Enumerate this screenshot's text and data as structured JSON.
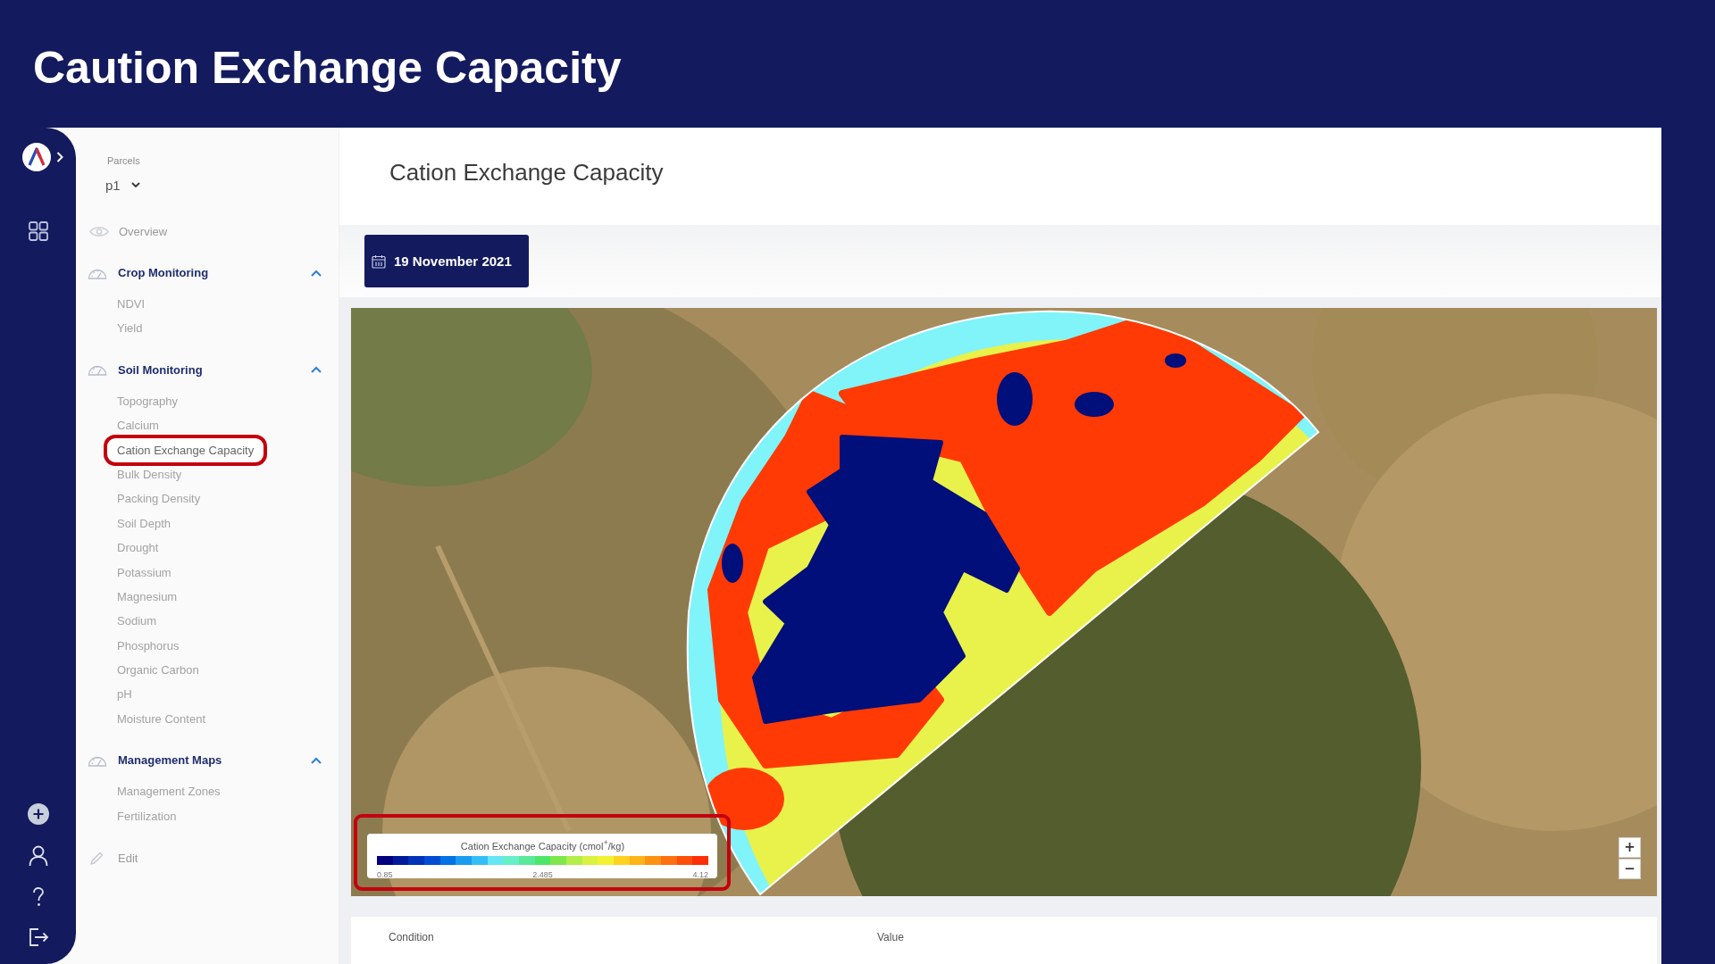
{
  "banner": {
    "title": "Caution Exchange Capacity"
  },
  "sidebar": {
    "parcels": {
      "label": "Parcels",
      "value": "p1"
    },
    "overview": {
      "label": "Overview"
    },
    "sections": [
      {
        "label": "Crop Monitoring",
        "expanded": true,
        "children": [
          {
            "label": "NDVI",
            "selected": false
          },
          {
            "label": "Yield",
            "selected": false
          }
        ]
      },
      {
        "label": "Soil Monitoring",
        "expanded": true,
        "children": [
          {
            "label": "Topography",
            "selected": false
          },
          {
            "label": "Calcium",
            "selected": false
          },
          {
            "label": "Cation Exchange Capacity",
            "selected": true
          },
          {
            "label": "Bulk Density",
            "selected": false
          },
          {
            "label": "Packing Density",
            "selected": false
          },
          {
            "label": "Soil Depth",
            "selected": false
          },
          {
            "label": "Drought",
            "selected": false
          },
          {
            "label": "Potassium",
            "selected": false
          },
          {
            "label": "Magnesium",
            "selected": false
          },
          {
            "label": "Sodium",
            "selected": false
          },
          {
            "label": "Phosphorus",
            "selected": false
          },
          {
            "label": "Organic Carbon",
            "selected": false
          },
          {
            "label": "pH",
            "selected": false
          },
          {
            "label": "Moisture Content",
            "selected": false
          }
        ]
      },
      {
        "label": "Management Maps",
        "expanded": true,
        "children": [
          {
            "label": "Management Zones",
            "selected": false
          },
          {
            "label": "Fertilization",
            "selected": false
          }
        ]
      }
    ],
    "edit": {
      "label": "Edit"
    }
  },
  "main": {
    "title": "Cation Exchange Capacity",
    "date_button": {
      "label": "19 November 2021"
    },
    "map": {
      "legend": {
        "title": "Cation Exchange Capacity (cmol$^{+}$/kg)",
        "highlighted": true,
        "segments": [
          {
            "color": "#000080"
          },
          {
            "color": "#001a9c"
          },
          {
            "color": "#0033b8"
          },
          {
            "color": "#004dd4"
          },
          {
            "color": "#0073e6"
          },
          {
            "color": "#1a9cf0"
          },
          {
            "color": "#33bff5"
          },
          {
            "color": "#66e6f5"
          },
          {
            "color": "#66f0c8"
          },
          {
            "color": "#5ae89a"
          },
          {
            "color": "#4ee66a"
          },
          {
            "color": "#80e64d"
          },
          {
            "color": "#b3ee4a"
          },
          {
            "color": "#d9f240"
          },
          {
            "color": "#f2f233"
          },
          {
            "color": "#ffd21f"
          },
          {
            "color": "#ffb31a"
          },
          {
            "color": "#ff9214"
          },
          {
            "color": "#ff700f"
          },
          {
            "color": "#ff4d0a"
          },
          {
            "color": "#ff2e05"
          }
        ],
        "ticks": [
          "0.85",
          "2.485",
          "4.12"
        ]
      },
      "zoom_controls": [
        "+",
        "−"
      ]
    },
    "table": {
      "columns": [
        "Condition",
        "Value"
      ]
    }
  }
}
